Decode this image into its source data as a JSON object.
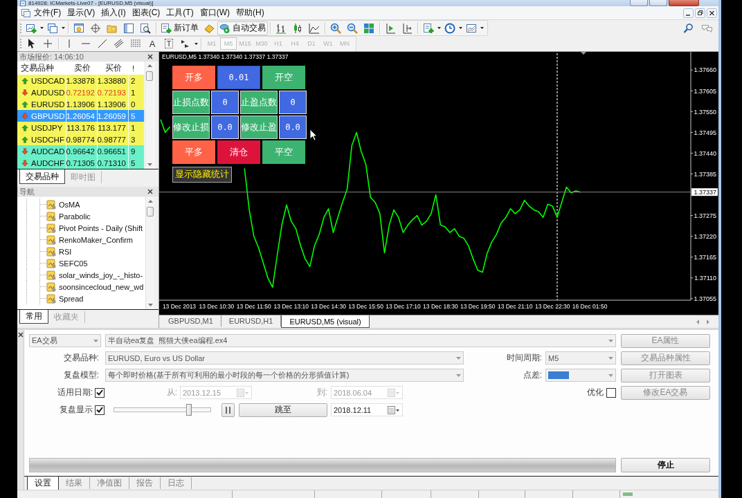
{
  "window": {
    "title": "814928: ICMarkets-Live07 - [EURUSD,M5 (visual)]"
  },
  "menu": [
    "文件(F)",
    "显示(V)",
    "插入(I)",
    "图表(C)",
    "工具(T)",
    "窗口(W)",
    "帮助(H)"
  ],
  "toolbar": {
    "new_order": "新订单",
    "auto_trading": "自动交易"
  },
  "drawing_tools": {
    "text": "A",
    "label": "T"
  },
  "timeframes": [
    {
      "label": "M1",
      "selected": false,
      "disabled": true
    },
    {
      "label": "M5",
      "selected": true,
      "disabled": true
    },
    {
      "label": "M15",
      "selected": false,
      "disabled": true
    },
    {
      "label": "M30",
      "selected": false,
      "disabled": true
    },
    {
      "label": "H1",
      "selected": false,
      "disabled": true
    },
    {
      "label": "H4",
      "selected": false,
      "disabled": true
    },
    {
      "label": "D1",
      "selected": false,
      "disabled": true
    },
    {
      "label": "W1",
      "selected": false,
      "disabled": true
    },
    {
      "label": "MN",
      "selected": false,
      "disabled": true
    }
  ],
  "market_watch": {
    "title": "市场报价: 14:06:10",
    "columns": [
      "交易品种",
      "卖价",
      "买价",
      "!"
    ],
    "rows": [
      {
        "symbol": "USDCAD",
        "bid": "1.33878",
        "ask": "1.33880",
        "spread": "2",
        "rising": true,
        "price_falling": false,
        "selected": false,
        "color": "#f5f55a"
      },
      {
        "symbol": "AUDUSD",
        "bid": "0.72192",
        "ask": "0.72193",
        "spread": "1",
        "rising": false,
        "price_falling": true,
        "selected": false,
        "color": "#f5f55a"
      },
      {
        "symbol": "EURUSD",
        "bid": "1.13906",
        "ask": "1.13906",
        "spread": "0",
        "rising": true,
        "price_falling": false,
        "selected": false,
        "color": "#f5f55a"
      },
      {
        "symbol": "GBPUSD",
        "bid": "1.26054",
        "ask": "1.26059",
        "spread": "5",
        "rising": false,
        "price_falling": false,
        "selected": true
      },
      {
        "symbol": "USDJPY",
        "bid": "113.176",
        "ask": "113.177",
        "spread": "1",
        "rising": true,
        "price_falling": false,
        "selected": false,
        "color": "#f5f55a"
      },
      {
        "symbol": "USDCHF",
        "bid": "0.98774",
        "ask": "0.98777",
        "spread": "3",
        "rising": true,
        "price_falling": false,
        "selected": false,
        "color": "#f5f55a"
      },
      {
        "symbol": "AUDCAD",
        "bid": "0.96642",
        "ask": "0.96651",
        "spread": "9",
        "rising": false,
        "price_falling": false,
        "selected": false,
        "color": "#6af0c8"
      },
      {
        "symbol": "AUDCHF",
        "bid": "0.71305",
        "ask": "0.71310",
        "spread": "5",
        "rising": false,
        "price_falling": false,
        "selected": false,
        "color": "#6af0c8"
      }
    ],
    "tabs": [
      {
        "label": "交易品种",
        "selected": true
      },
      {
        "label": "即时图",
        "selected": false
      }
    ]
  },
  "navigator": {
    "title": "导航",
    "items": [
      "OsMA",
      "Parabolic",
      "Pivot Points - Daily (Shift",
      "RenkoMaker_Confirm",
      "RSI",
      "SEFC05",
      "solar_winds_joy_-_histo-",
      "soonsincecloud_new_wd",
      "Spread"
    ],
    "tabs": [
      {
        "label": "常用",
        "selected": true
      },
      {
        "label": "收藏夹",
        "selected": false
      }
    ]
  },
  "chart": {
    "header": "EURUSD,M5 1.37340 1.37340 1.37337 1.37337",
    "panel": {
      "rows": [
        [
          {
            "label": "开多",
            "kind": "button",
            "color": "#ff6347"
          },
          {
            "label": "0.01",
            "kind": "field",
            "color": "#4169e1"
          },
          {
            "label": "开空",
            "kind": "button",
            "color": "#3cb371"
          }
        ],
        [
          {
            "label": "止损点数",
            "kind": "button",
            "color": "#3cb371"
          },
          {
            "label": "0",
            "kind": "field",
            "color": "#4169e1"
          },
          {
            "label": "止盈点数",
            "kind": "button",
            "color": "#3cb371"
          },
          {
            "label": "0",
            "kind": "field",
            "color": "#4169e1"
          }
        ],
        [
          {
            "label": "修改止损",
            "kind": "button",
            "color": "#3cb371"
          },
          {
            "label": "0.0",
            "kind": "field",
            "color": "#4169e1"
          },
          {
            "label": "修改止盈",
            "kind": "button",
            "color": "#3cb371"
          },
          {
            "label": "0.0",
            "kind": "field",
            "color": "#4169e1"
          }
        ],
        [
          {
            "label": "平多",
            "kind": "button",
            "color": "#ff6347"
          },
          {
            "label": "清仓",
            "kind": "button",
            "color": "#dc143c"
          },
          {
            "label": "平空",
            "kind": "button",
            "color": "#3cb371"
          }
        ]
      ],
      "stats_toggle": "显示隐藏统计"
    },
    "chart_data": {
      "type": "line",
      "categories": [
        null,
        null,
        null,
        null,
        "13 Dec 2013",
        null,
        null,
        null,
        null,
        null,
        null,
        null,
        "13 Dec 10:30",
        null,
        null,
        null,
        null,
        null,
        null,
        null,
        "13 Dec 11:50",
        null,
        null,
        null,
        null,
        null,
        null,
        null,
        "13 Dec 13:10",
        null,
        null,
        null,
        null,
        null,
        null,
        null,
        "13 Dec 14:30",
        null,
        null,
        null,
        null,
        null,
        null,
        null,
        "13 Dec 15:50",
        null,
        null,
        null,
        null,
        null,
        null,
        null,
        "13 Dec 17:10",
        null,
        null,
        null,
        null,
        null,
        null,
        null,
        "13 Dec 18:30",
        null,
        null,
        null,
        null,
        null,
        null,
        null,
        "13 Dec 19:50",
        null,
        null,
        null,
        null,
        null,
        null,
        null,
        "13 Dec 21:10",
        null,
        null,
        null,
        null,
        null,
        null,
        null,
        "13 Dec 22:30",
        null,
        null,
        null,
        null,
        null,
        null,
        null,
        "16 Dec 01:50",
        null,
        null,
        null,
        null,
        null,
        null,
        null,
        null,
        null,
        null,
        null,
        null,
        null,
        null,
        null,
        null,
        null,
        null,
        null,
        null,
        null
      ],
      "series": [
        {
          "color": "#00ff00",
          "values": [
            1.37529,
            1.37495,
            1.3751,
            null,
            null,
            null,
            null,
            null,
            null,
            null,
            null,
            null,
            null,
            null,
            null,
            null,
            null,
            null,
            1.374,
            1.3729,
            1.3722,
            1.3719,
            1.3715,
            1.3711,
            1.37085,
            1.3717,
            1.3725,
            1.37303,
            1.3726,
            1.3724,
            1.37196,
            1.3716,
            1.3714,
            1.37195,
            1.37225,
            1.3727,
            1.37293,
            1.3723,
            1.3727,
            1.3731,
            1.37345,
            1.3746,
            1.37495,
            1.37445,
            1.3741,
            1.37323,
            1.3731,
            1.3728,
            1.37176,
            1.3725,
            1.3729,
            1.3727,
            1.3723,
            1.3725,
            1.37264,
            1.37275,
            1.3725,
            1.3726,
            1.3728,
            1.3733,
            1.3725,
            1.37245,
            1.3723,
            1.3724,
            1.3722,
            1.37215,
            1.37195,
            1.3716,
            1.3713,
            1.37125,
            1.37175,
            1.37205,
            1.37225,
            1.37255,
            1.3727,
            1.37293,
            1.3728,
            1.3729,
            1.37315,
            1.373,
            1.3729,
            1.37285,
            1.3727,
            1.37305,
            1.373,
            1.3727,
            1.3731,
            1.3735,
            1.37335,
            1.3734,
            1.37337,
            null,
            null,
            null,
            null,
            null,
            null,
            null,
            null,
            null,
            null,
            null,
            null,
            null,
            null,
            null,
            null,
            null,
            null,
            null,
            null,
            null,
            null,
            null
          ]
        }
      ],
      "ylim": [
        1.37051,
        1.37708
      ],
      "yticks": [
        {
          "value": 1.37055,
          "label": "1.37055"
        },
        {
          "value": 1.3711,
          "label": "1.37110"
        },
        {
          "value": 1.37165,
          "label": "1.37165"
        },
        {
          "value": 1.3722,
          "label": "1.37220"
        },
        {
          "value": 1.37275,
          "label": "1.37275"
        },
        {
          "value": 1.37385,
          "label": "1.37385"
        },
        {
          "value": 1.3744,
          "label": "1.37440"
        },
        {
          "value": 1.37495,
          "label": "1.37495"
        },
        {
          "value": 1.3755,
          "label": "1.37550"
        },
        {
          "value": 1.37605,
          "label": "1.37605"
        },
        {
          "value": 1.3766,
          "label": "1.37660"
        }
      ],
      "ref_lines": [
        {
          "axis": "y",
          "value": 1.37337,
          "label": "1.37337"
        }
      ]
    }
  },
  "chart_tabs": [
    {
      "label": "GBPUSD,M1",
      "selected": false
    },
    {
      "label": "EURUSD,H1",
      "selected": false
    },
    {
      "label": "EURUSD,M5 (visual)",
      "selected": true
    }
  ],
  "tester": {
    "type_select": "EA交易",
    "expert_select": "半自动ea复盘  熊猫大侠ea编程.ex4",
    "symbol_label": "交易品种:",
    "symbol_select": "EURUSD, Euro vs US Dollar",
    "period_label": "时间周期:",
    "period_select": "M5",
    "model_label": "复盘模型:",
    "model_select": "每个即时价格(基于所有可利用的最小时段的每一个价格的分形插值计算)",
    "spread": {
      "label": "点差:",
      "focused": true
    },
    "use_date": {
      "label": "适用日期:",
      "checked": true
    },
    "from": {
      "label": "从:",
      "value": "2013.12.15",
      "disabled": true
    },
    "to": {
      "label": "到:",
      "value": "2018.06.04",
      "disabled": true
    },
    "optimization": {
      "label": "优化",
      "checked": false
    },
    "visual": {
      "label": "复盘显示",
      "checked": true
    },
    "speed": {
      "level": 0.79
    },
    "skip_button": "跳至",
    "skip_date": "2018.12.11",
    "buttons": [
      {
        "label": "EA属性",
        "disabled": true
      },
      {
        "label": "交易品种属性",
        "disabled": true
      },
      {
        "label": "打开图表",
        "disabled": true
      },
      {
        "label": "修改EA交易",
        "disabled": true
      }
    ],
    "progress": {
      "level": 1
    },
    "stop_button": "停止"
  },
  "tester_tabs": [
    {
      "label": "设置",
      "selected": true
    },
    {
      "label": "结果",
      "selected": false
    },
    {
      "label": "净值图",
      "selected": false
    },
    {
      "label": "报告",
      "selected": false
    },
    {
      "label": "日志",
      "selected": false
    }
  ]
}
